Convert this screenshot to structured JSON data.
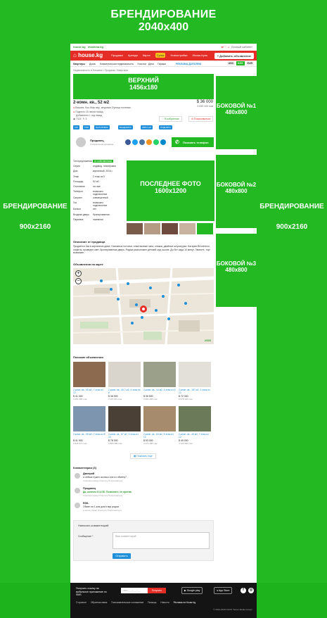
{
  "branding": {
    "top_label": "БРЕНДИРОВАНИЕ",
    "top_size": "2040x400",
    "side_label": "БРЕНДИРОВАНИЕ",
    "side_size": "900x2160"
  },
  "topbar": {
    "logo1": "house.kg",
    "logo2": "mashina.kg",
    "right_links": "Личный кабинет"
  },
  "header": {
    "logo": "house.kg",
    "nav": [
      "Продажа",
      "Аренда",
      "Карта",
      "Сутки",
      "Новостройки",
      "Иссык-Куль"
    ],
    "highlighted_nav": "Сутки",
    "add_button": "+ Добавить объявление"
  },
  "subnav": {
    "items": [
      "Квартиры",
      "Дома",
      "Коммерческая недвижимость",
      "Участки",
      "Дачи",
      "Гаражи"
    ],
    "promo": "РЕКЛАМА ДОПОЛНИ",
    "currencies": [
      "USD",
      "KGS",
      "EUR"
    ],
    "active_currency": "KGS"
  },
  "breadcrumbs": "Недвижимость в Бишкеке  /  Продажа  /  Квартиры",
  "banners": {
    "top": {
      "label": "ВЕРХНИЙ",
      "size": "1456x180"
    },
    "side1": {
      "label": "БОКОВОЙ №1",
      "size": "480x800"
    },
    "side2": {
      "label": "БОКОВОЙ №2",
      "size": "480x800"
    },
    "side3": {
      "label": "БОКОВОЙ №3",
      "size": "480x800"
    },
    "photo": {
      "label": "ПОСЛЕДНЕЕ ФОТО",
      "size": "1600x1200"
    }
  },
  "listing": {
    "title": "2-комн. кв., 52 м2",
    "price_usd": "$ 36 000",
    "price_som": "3 039 100 сом",
    "address": "Бишкек, Кок-Жар мкр, медовая 2/улица полевая",
    "updated": "Поднято 15 часов назад",
    "added": "Добавлено 1 год назад",
    "views": "7114",
    "favorite": "В избранное",
    "complain": "Пожаловаться"
  },
  "tags": [
    "VIP",
    "ТОП",
    "ЗАГОЛОВОК",
    "ВЫДЕЛИТЬ",
    "АВТО-UP",
    "ПОДНЯТЬ"
  ],
  "seller": {
    "name": "Продавец",
    "sub": "3 объявления продавца",
    "phone_button": "Показать телефон"
  },
  "specs": [
    {
      "k": "Тип предложения",
      "v": "от собственника",
      "badge": true
    },
    {
      "k": "Серия",
      "v": "индивид. планировка"
    },
    {
      "k": "Дом",
      "v": "кирпичный, 2016 г."
    },
    {
      "k": "Этаж",
      "v": "2 этаж из 5"
    },
    {
      "k": "Площадь",
      "v": "52 м2"
    },
    {
      "k": "Отопление",
      "v": "на газе"
    },
    {
      "k": "Телефон",
      "v": "возможно подключение"
    },
    {
      "k": "Санузел",
      "v": "совмещенный"
    },
    {
      "k": "Газ",
      "v": "возможно подключение"
    },
    {
      "k": "Балкон",
      "v": "нет"
    },
    {
      "k": "Входная дверь",
      "v": "бронированная"
    },
    {
      "k": "Парковка",
      "v": "наземная"
    }
  ],
  "description": {
    "title": "Описание от продавца",
    "text": "Продается 2кв в кирпичном доме. Натяжные потолки, пластиковые окна, стяжка, двойные штукатурка. Батареи ВК-метеол, софиты, проведен свет, бронированная дверь. Рядом расположен детский сад, школа. До бот сада 10 минут. Звоните, торг возможен."
  },
  "map": {
    "title": "Объявления на карте",
    "zoom_in": "+",
    "zoom_out": "−",
    "attribution": "2GIS"
  },
  "similar": {
    "title": "Похожие объявления",
    "cards": [
      {
        "t": "2-комн. кв., 55 м2, 7 этаж из 13",
        "p": "$ 41 000",
        "s": "3 461 280 сом"
      },
      {
        "t": "2-комн. кв., 45.7 м2, 4 этаж из 8",
        "p": "$ 36 900",
        "s": "3 115 031 сом"
      },
      {
        "t": "2-комн. кв., 44 м2, 3 этаж из 5",
        "p": "$ 36 500",
        "s": "3 081 265 сом"
      },
      {
        "t": "2-комн. кв., 187 м2, 3 этаж из 12",
        "p": "$ 72 000",
        "s": "6 078 166 сом"
      },
      {
        "t": "2-комн. кв., 55 м2, 2 этаж из 8",
        "p": "$ 41 900",
        "s": "3 536 971 сом"
      },
      {
        "t": "2-комн. кв., 87 м2, 9 этаж из 10",
        "p": "$ 78 000",
        "s": "6 584 680 сом"
      },
      {
        "t": "2-комн. кв., 60 м2, 8 этаж из 12",
        "p": "$ 53 000",
        "s": "4 474 180 сом"
      },
      {
        "t": "2-комн. кв., 46 м2, 7 этаж из 12",
        "p": "$ 49 000",
        "s": "4 136 560 сом"
      }
    ],
    "show_more": "Показать еще"
  },
  "comments": {
    "title": "Комментарии (3)",
    "items": [
      {
        "name": "Дмитрий",
        "text": "А сейчас нужно сколько сом по обмену?",
        "meta": "3 месяца назад     Ответить     Пожаловаться",
        "green": false
      },
      {
        "name": "Продавец",
        "text": "Да, конечно 8 14 80. Позвоните, не против.",
        "meta": "3 месяца назад     Ответить     Пожаловаться",
        "green": true
      },
      {
        "name": "EDIL",
        "text": "Обмен на 1-ком дом в мкр рядом",
        "meta": "1 месяц назад     Ответить     Пожаловаться",
        "green": false
      }
    ]
  },
  "write_comment": {
    "title": "Написать комментарий",
    "label": "Сообщение *",
    "placeholder": "Ваш комментарий",
    "send": "Отправить"
  },
  "footer": {
    "promo": "Получить ссылку на мобильное приложение по SMS",
    "phone_placeholder": "+996 (___) ___-___",
    "get_button": "Получить",
    "google": "Google play",
    "apple": "App Store",
    "links": [
      "О проекте",
      "Обратная связь",
      "Пользовательское соглашение",
      "Помощь",
      "Новости",
      "Реклама на House.kg"
    ],
    "copyright": "© 2010-2020 OcOO \"Sever Media Group\""
  }
}
